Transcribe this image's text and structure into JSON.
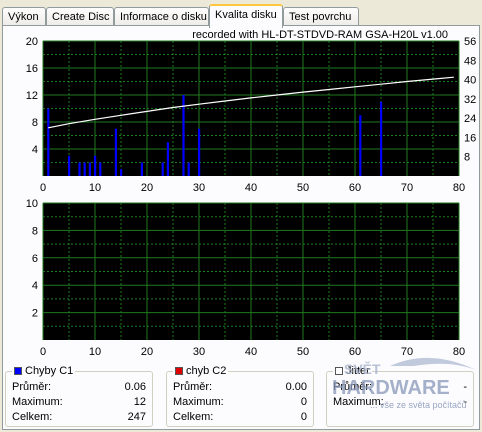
{
  "tabs": [
    {
      "label": "Výkon",
      "active": false
    },
    {
      "label": "Create Disc",
      "active": false
    },
    {
      "label": "Informace o disku",
      "active": false
    },
    {
      "label": "Kvalita disku",
      "active": true
    },
    {
      "label": "Test povrchu",
      "active": false
    }
  ],
  "recorded_text": "recorded with HL-DT-STDVD-RAM GSA-H20L v1.00",
  "colors": {
    "plot_bg": "#000000",
    "grid": "#1e7a1e",
    "c1": "#0000ff",
    "c2": "#e00000",
    "speed": "#ffffff",
    "tab_highlight": "#ffc83c"
  },
  "chart_data": [
    {
      "type": "bar",
      "name": "upper",
      "xlim": [
        0,
        80
      ],
      "ylim": [
        0,
        20
      ],
      "y2lim": [
        0,
        56
      ],
      "x_ticks": [
        "0",
        "10",
        "20",
        "30",
        "40",
        "50",
        "60",
        "70",
        "80"
      ],
      "y_ticks": [
        "4",
        "8",
        "12",
        "16",
        "20"
      ],
      "y2_ticks": [
        "8",
        "16",
        "24",
        "32",
        "40",
        "48",
        "56"
      ],
      "grid": true,
      "bars_x": [
        1,
        5,
        7,
        8,
        9,
        10,
        11,
        14,
        15,
        19,
        23,
        24,
        27,
        28,
        30,
        61,
        65
      ],
      "bars_y": [
        10,
        3,
        2,
        2,
        2,
        3,
        2,
        7,
        1,
        2,
        2,
        5,
        12,
        2,
        7,
        9,
        11
      ],
      "speed_x": [
        1,
        5,
        10,
        15,
        20,
        25,
        30,
        35,
        40,
        45,
        50,
        55,
        60,
        65,
        70,
        75,
        79
      ],
      "speed_y": [
        20,
        21.7,
        23.5,
        25.2,
        26.8,
        28.4,
        29.8,
        31.1,
        32.4,
        33.6,
        34.8,
        35.9,
        37,
        38.1,
        39.2,
        40.2,
        41
      ]
    },
    {
      "type": "bar",
      "name": "lower",
      "xlim": [
        0,
        80
      ],
      "ylim": [
        0,
        10
      ],
      "x_ticks": [
        "0",
        "10",
        "20",
        "30",
        "40",
        "50",
        "60",
        "70",
        "80"
      ],
      "y_ticks": [
        "2",
        "4",
        "6",
        "8",
        "10"
      ],
      "grid": true,
      "bars_x": [],
      "bars_y": []
    }
  ],
  "stats": {
    "c1": {
      "title": "Chyby C1",
      "avg_label": "Průměr:",
      "avg": "0.06",
      "max_label": "Maximum:",
      "max": "12",
      "total_label": "Celkem:",
      "total": "247"
    },
    "c2": {
      "title": "chyb C2",
      "avg_label": "Průměr:",
      "avg": "0.00",
      "max_label": "Maximum:",
      "max": "0",
      "total_label": "Celkem:",
      "total": "0"
    },
    "jitter": {
      "title": "Jitter",
      "avg_label": "Průměr:",
      "avg": "-",
      "max_label": "Maximum:",
      "max": "-"
    }
  },
  "watermark": {
    "line1": "SVĚT",
    "line2": "HARDWARE",
    "tagline": "... vše ze světa počítačů"
  }
}
